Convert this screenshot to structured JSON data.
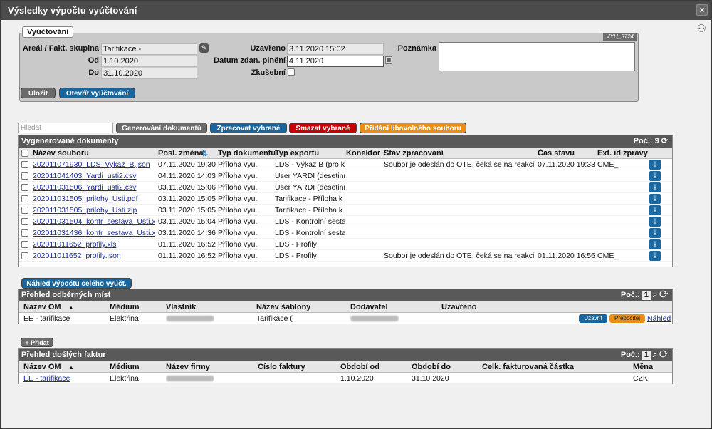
{
  "window": {
    "title": "Výsledky výpočtu vyúčtování",
    "close": "×"
  },
  "form": {
    "legend": "Vyúčtování",
    "code": "VYU_5724",
    "areal_label": "Areál / Fakt. skupina",
    "areal_value": "Tarifikace -",
    "od_label": "Od",
    "od_value": "1.10.2020",
    "do_label": "Do",
    "do_value": "31.10.2020",
    "uzavreno_label": "Uzavřeno",
    "uzavreno_value": "3.11.2020 15:02",
    "datum_label": "Datum zdan. plnění",
    "datum_value": "4.11.2020",
    "zkusebni_label": "Zkušební",
    "poznamka_label": "Poznámka",
    "save_label": "Uložit",
    "open_label": "Otevřít vyúčtování"
  },
  "toolbar": {
    "search_placeholder": "Hledat",
    "generate_label": "Generování dokumentů",
    "process_label": "Zpracovat vybrané",
    "delete_label": "Smazat vybrané",
    "add_file_label": "Přidání libovolného souboru"
  },
  "docs": {
    "title": "Vygenerované dokumenty",
    "count": "Poč.: 9",
    "columns": [
      "Název souboru",
      "Posl. změna",
      "Typ dokumentu",
      "Typ exportu",
      "Konektor",
      "Stav zpracování",
      "Čas stavu",
      "Ext. id zprávy"
    ],
    "rows": [
      {
        "name": "202011071930_LDS_Vykaz_B.json",
        "changed": "07.11.2020 19:30",
        "type": "Příloha vyu.",
        "export": "LDS - Výkaz B (pro ko",
        "connector": "",
        "status": "Soubor je odeslán do OTE, čeká se na reakci od",
        "time": "07.11.2020 19:33",
        "ext": "CME_"
      },
      {
        "name": "202011041403_Yardi_usti2.csv",
        "changed": "04.11.2020 14:03",
        "type": "Příloha vyu.",
        "export": "User YARDI (desetinn",
        "connector": "",
        "status": "",
        "time": "",
        "ext": ""
      },
      {
        "name": "202011031506_Yardi_usti2.csv",
        "changed": "03.11.2020 15:06",
        "type": "Příloha vyu.",
        "export": "User YARDI (desetinn",
        "connector": "",
        "status": "",
        "time": "",
        "ext": ""
      },
      {
        "name": "202011031505_prilohy_Usti.pdf",
        "changed": "03.11.2020 15:05",
        "type": "Příloha vyu.",
        "export": "Tarifikace - Příloha k fa",
        "connector": "",
        "status": "",
        "time": "",
        "ext": ""
      },
      {
        "name": "202011031505_prilohy_Usti.zip",
        "changed": "03.11.2020 15:05",
        "type": "Příloha vyu.",
        "export": "Tarifikace - Příloha k fa",
        "connector": "",
        "status": "",
        "time": "",
        "ext": ""
      },
      {
        "name": "202011031504_kontr_sestava_Usti.xls",
        "changed": "03.11.2020 15:04",
        "type": "Příloha vyu.",
        "export": "LDS - Kontrolní sestav",
        "connector": "",
        "status": "",
        "time": "",
        "ext": ""
      },
      {
        "name": "202011031436_kontr_sestava_Usti.xls",
        "changed": "03.11.2020 14:36",
        "type": "Příloha vyu.",
        "export": "LDS - Kontrolní sestav",
        "connector": "",
        "status": "",
        "time": "",
        "ext": ""
      },
      {
        "name": "202011011652_profily.xls",
        "changed": "01.11.2020 16:52",
        "type": "Příloha vyu.",
        "export": "LDS - Profily",
        "connector": "",
        "status": "",
        "time": "",
        "ext": ""
      },
      {
        "name": "202011011652_profily.json",
        "changed": "01.11.2020 16:52",
        "type": "Příloha vyu.",
        "export": "LDS - Profily",
        "connector": "",
        "status": "Soubor je odeslán do OTE, čeká se na reakci od",
        "time": "01.11.2020 16:56",
        "ext": "CME_"
      }
    ]
  },
  "preview_button": "Náhled výpočtu celého vyúčt.",
  "om": {
    "title": "Přehled odběrných míst",
    "count_label": "Poč.:",
    "count": "1",
    "columns": [
      "Název OM",
      "Médium",
      "Vlastník",
      "Název šablony",
      "Dodavatel",
      "Uzavřeno"
    ],
    "row": {
      "name": "EE - tarifikace",
      "medium": "Elektřina",
      "template": "Tarifikace (",
      "close_btn": "Uzavřít",
      "recalc_btn": "Přepočítej",
      "preview": "Náhled"
    }
  },
  "add_label": "+ Přidat",
  "invoices": {
    "title": "Přehled došlých faktur",
    "count_label": "Poč.:",
    "count": "1",
    "columns": [
      "Název OM",
      "Médium",
      "Název firmy",
      "Číslo faktury",
      "Období od",
      "Období do",
      "Celk. fakturovaná částka",
      "Měna"
    ],
    "row": {
      "name": "EE - tarifikace",
      "medium": "Elektřina",
      "from": "1.10.2020",
      "to": "31.10.2020",
      "currency": "CZK"
    }
  }
}
